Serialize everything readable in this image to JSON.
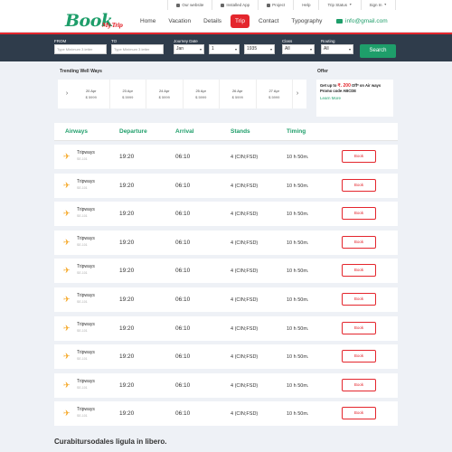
{
  "topbar": {
    "items": [
      {
        "label": "Our website",
        "icon": "list-icon"
      },
      {
        "label": "Installed App",
        "icon": "mobile-icon"
      },
      {
        "label": "Project",
        "icon": "cart-icon"
      },
      {
        "label": "Help",
        "icon": ""
      },
      {
        "label": "Trip Status",
        "icon": "",
        "caret": true
      },
      {
        "label": "Sign In",
        "icon": "",
        "caret": true
      }
    ]
  },
  "header": {
    "logo": "Book",
    "logo_sub": "My Trip",
    "nav": [
      "Home",
      "Vacation",
      "Details",
      "Trip",
      "Contact",
      "Typography"
    ],
    "active_nav": "Trip",
    "email": "info@gmail.com"
  },
  "search": {
    "from_label": "FROM",
    "from_placeholder": "Type Minimum 3 letter",
    "to_label": "TO",
    "to_placeholder": "Type Minimum 3 letter",
    "date_label": "Journey Date",
    "month": "Jan",
    "day": "1",
    "year": "1935",
    "class_label": "Class",
    "class_value": "All",
    "routing_label": "Routing",
    "routing_value": "All",
    "button": "Search"
  },
  "trending": {
    "title": "Trending Well Ways",
    "items": [
      {
        "date": "20 Apr",
        "price": "$ 5999"
      },
      {
        "date": "23 Apr",
        "price": "$ 5999"
      },
      {
        "date": "24 Apr",
        "price": "$ 5999"
      },
      {
        "date": "25 Apr",
        "price": "$ 5999"
      },
      {
        "date": "26 Apr",
        "price": "$ 5999"
      },
      {
        "date": "27 Apr",
        "price": "$ 5999"
      }
    ]
  },
  "offer": {
    "title": "Offer",
    "line1_pre": "Get up to ",
    "line1_amount": "₹. 200",
    "line1_post": " Off* on Air ways",
    "line2": "Promo code ABCDE",
    "link": "Learn More"
  },
  "table": {
    "headers": [
      "Airways",
      "Departure",
      "Arrival",
      "Stands",
      "Timing"
    ],
    "rows": [
      {
        "airline": "Tripways",
        "code": "SE-101",
        "departure": "19:20",
        "arrival": "06:10",
        "stands": "4 (CIN;FSD)",
        "timing": "10 h 50m.",
        "book": "Book"
      },
      {
        "airline": "Tripways",
        "code": "SE-101",
        "departure": "19:20",
        "arrival": "06:10",
        "stands": "4 (CIN;FSD)",
        "timing": "10 h 50m.",
        "book": "Book"
      },
      {
        "airline": "Tripways",
        "code": "SE-101",
        "departure": "19:20",
        "arrival": "06:10",
        "stands": "4 (CIN;FSD)",
        "timing": "10 h 50m.",
        "book": "Book"
      },
      {
        "airline": "Tripways",
        "code": "SE-101",
        "departure": "19:20",
        "arrival": "06:10",
        "stands": "4 (CIN;FSD)",
        "timing": "10 h 50m.",
        "book": "Book"
      },
      {
        "airline": "Tripways",
        "code": "SE-101",
        "departure": "19:20",
        "arrival": "06:10",
        "stands": "4 (CIN;FSD)",
        "timing": "10 h 50m.",
        "book": "Book"
      },
      {
        "airline": "Tripways",
        "code": "SE-101",
        "departure": "19:20",
        "arrival": "06:10",
        "stands": "4 (CIN;FSD)",
        "timing": "10 h 50m.",
        "book": "Book"
      },
      {
        "airline": "Tripways",
        "code": "SE-101",
        "departure": "19:20",
        "arrival": "06:10",
        "stands": "4 (CIN;FSD)",
        "timing": "10 h 50m.",
        "book": "Book"
      },
      {
        "airline": "Tripways",
        "code": "SE-101",
        "departure": "19:20",
        "arrival": "06:10",
        "stands": "4 (CIN;FSD)",
        "timing": "10 h 50m.",
        "book": "Book"
      },
      {
        "airline": "Tripways",
        "code": "SE-101",
        "departure": "19:20",
        "arrival": "06:10",
        "stands": "4 (CIN;FSD)",
        "timing": "10 h 50m.",
        "book": "Book"
      },
      {
        "airline": "Tripways",
        "code": "SE-101",
        "departure": "19:20",
        "arrival": "06:10",
        "stands": "4 (CIN;FSD)",
        "timing": "10 h 50m.",
        "book": "Book"
      }
    ]
  },
  "footer_heading": "Curabitursodales ligula in libero.",
  "colors": {
    "brand": "#1e9e6a",
    "accent": "#e4262d",
    "band": "#2f3c4b",
    "plane": "#f5a623"
  }
}
